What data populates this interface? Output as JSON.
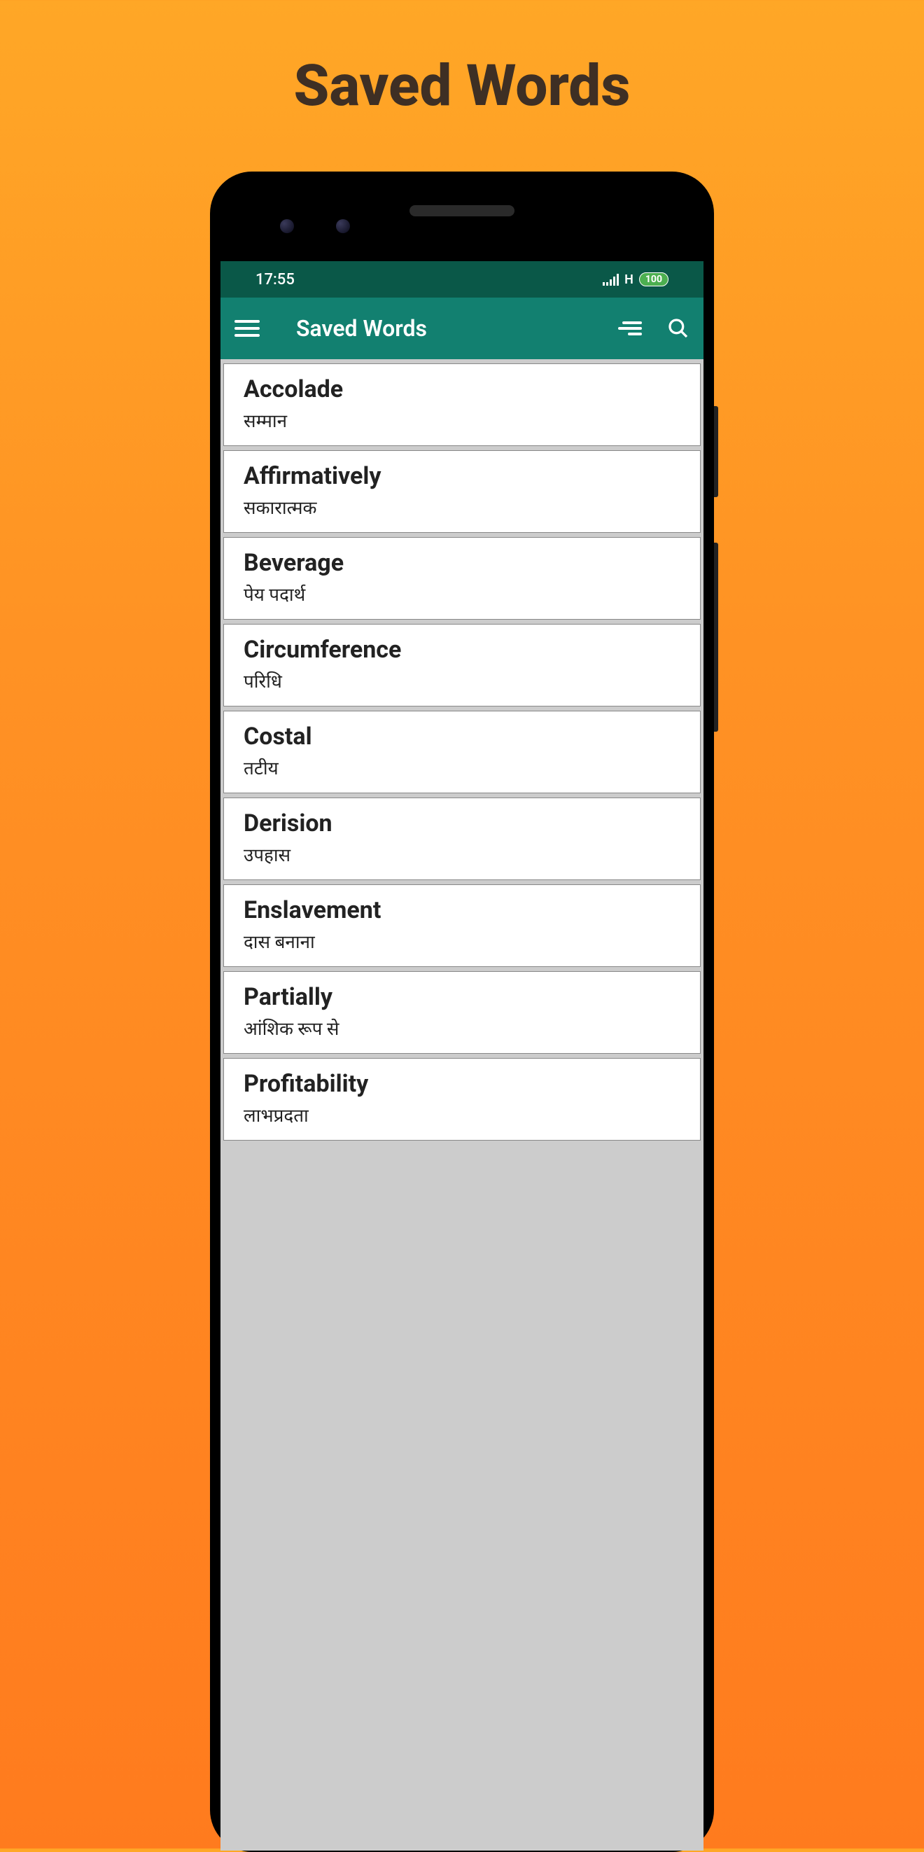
{
  "hero": {
    "title": "Saved Words"
  },
  "status": {
    "time": "17:55",
    "network": "H",
    "battery": "100"
  },
  "appbar": {
    "title": "Saved Words"
  },
  "words": [
    {
      "en": "Accolade",
      "hi": "सम्मान"
    },
    {
      "en": "Affirmatively",
      "hi": "सकारात्मक"
    },
    {
      "en": "Beverage",
      "hi": "पेय पदार्थ"
    },
    {
      "en": "Circumference",
      "hi": "परिधि"
    },
    {
      "en": "Costal",
      "hi": "तटीय"
    },
    {
      "en": "Derision",
      "hi": "उपहास"
    },
    {
      "en": "Enslavement",
      "hi": "दास बनाना"
    },
    {
      "en": "Partially",
      "hi": "आंशिक रूप से"
    },
    {
      "en": "Profitability",
      "hi": "लाभप्रदता"
    }
  ]
}
